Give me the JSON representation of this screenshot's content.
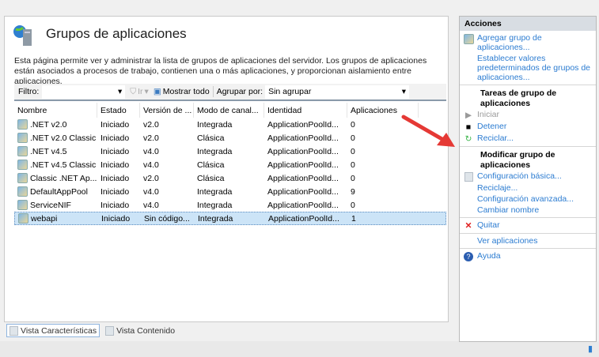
{
  "main": {
    "title": "Grupos de aplicaciones",
    "description": "Esta página permite ver y administrar la lista de grupos de aplicaciones del servidor. Los grupos de aplicaciones están asociados a procesos de trabajo, contienen una o más aplicaciones, y proporcionan aislamiento entre aplicaciones.",
    "toolbar": {
      "filter_label": "Filtro:",
      "filter_value": "",
      "go_label": "Ir",
      "show_all_label": "Mostrar todo",
      "group_by_label": "Agrupar por:",
      "group_by_value": "Sin agrupar"
    },
    "columns": [
      "Nombre",
      "Estado",
      "Versión de ...",
      "Modo de canal...",
      "Identidad",
      "Aplicaciones"
    ],
    "rows": [
      [
        ".NET v2.0",
        "Iniciado",
        "v2.0",
        "Integrada",
        "ApplicationPoolId...",
        "0"
      ],
      [
        ".NET v2.0 Classic",
        "Iniciado",
        "v2.0",
        "Clásica",
        "ApplicationPoolId...",
        "0"
      ],
      [
        ".NET v4.5",
        "Iniciado",
        "v4.0",
        "Integrada",
        "ApplicationPoolId...",
        "0"
      ],
      [
        ".NET v4.5 Classic",
        "Iniciado",
        "v4.0",
        "Clásica",
        "ApplicationPoolId...",
        "0"
      ],
      [
        "Classic .NET Ap...",
        "Iniciado",
        "v2.0",
        "Clásica",
        "ApplicationPoolId...",
        "0"
      ],
      [
        "DefaultAppPool",
        "Iniciado",
        "v4.0",
        "Integrada",
        "ApplicationPoolId...",
        "9"
      ],
      [
        "ServiceNIF",
        "Iniciado",
        "v4.0",
        "Integrada",
        "ApplicationPoolId...",
        "0"
      ],
      [
        "webapi",
        "Iniciado",
        "Sin código...",
        "Integrada",
        "ApplicationPoolId...",
        "1"
      ]
    ],
    "selected_row": 7
  },
  "views": {
    "features": "Vista Características",
    "content": "Vista Contenido"
  },
  "actions": {
    "header": "Acciones",
    "add_pool": "Agregar grupo de aplicaciones...",
    "set_defaults": "Establecer valores predeterminados de grupos de aplicaciones...",
    "tasks_title": "Tareas de grupo de aplicaciones",
    "start": "Iniciar",
    "stop": "Detener",
    "recycle": "Reciclar...",
    "modify_title": "Modificar grupo de aplicaciones",
    "basic": "Configuración básica...",
    "recycling": "Reciclaje...",
    "advanced": "Configuración avanzada...",
    "rename": "Cambiar nombre",
    "remove": "Quitar",
    "view_apps": "Ver aplicaciones",
    "help": "Ayuda"
  },
  "colors": {
    "link": "#2c7cd1",
    "selection": "#cce4f7",
    "arrow": "#e53935"
  }
}
